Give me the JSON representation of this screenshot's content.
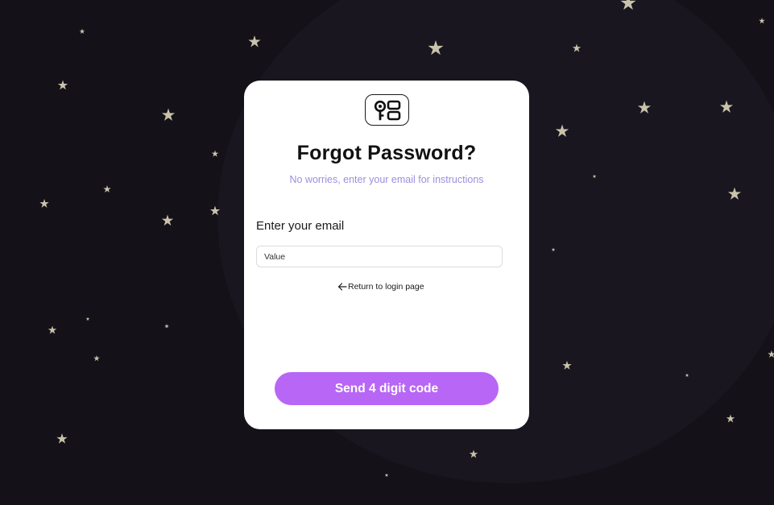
{
  "forgot_password": {
    "logo_icon": "key-icon",
    "title": "Forgot Password?",
    "subtitle": "No worries, enter your email for instructions",
    "email_label": "Enter your email",
    "email_placeholder": "Value",
    "email_value": "",
    "back_link_icon": "arrow-left-icon",
    "back_link_label": "Return to login page",
    "submit_label": "Send 4 digit code"
  },
  "colors": {
    "background": "#141119",
    "card": "#ffffff",
    "accent": "#b866f5",
    "subtitle": "#9b8fe0",
    "star": "#c8c3aa"
  }
}
